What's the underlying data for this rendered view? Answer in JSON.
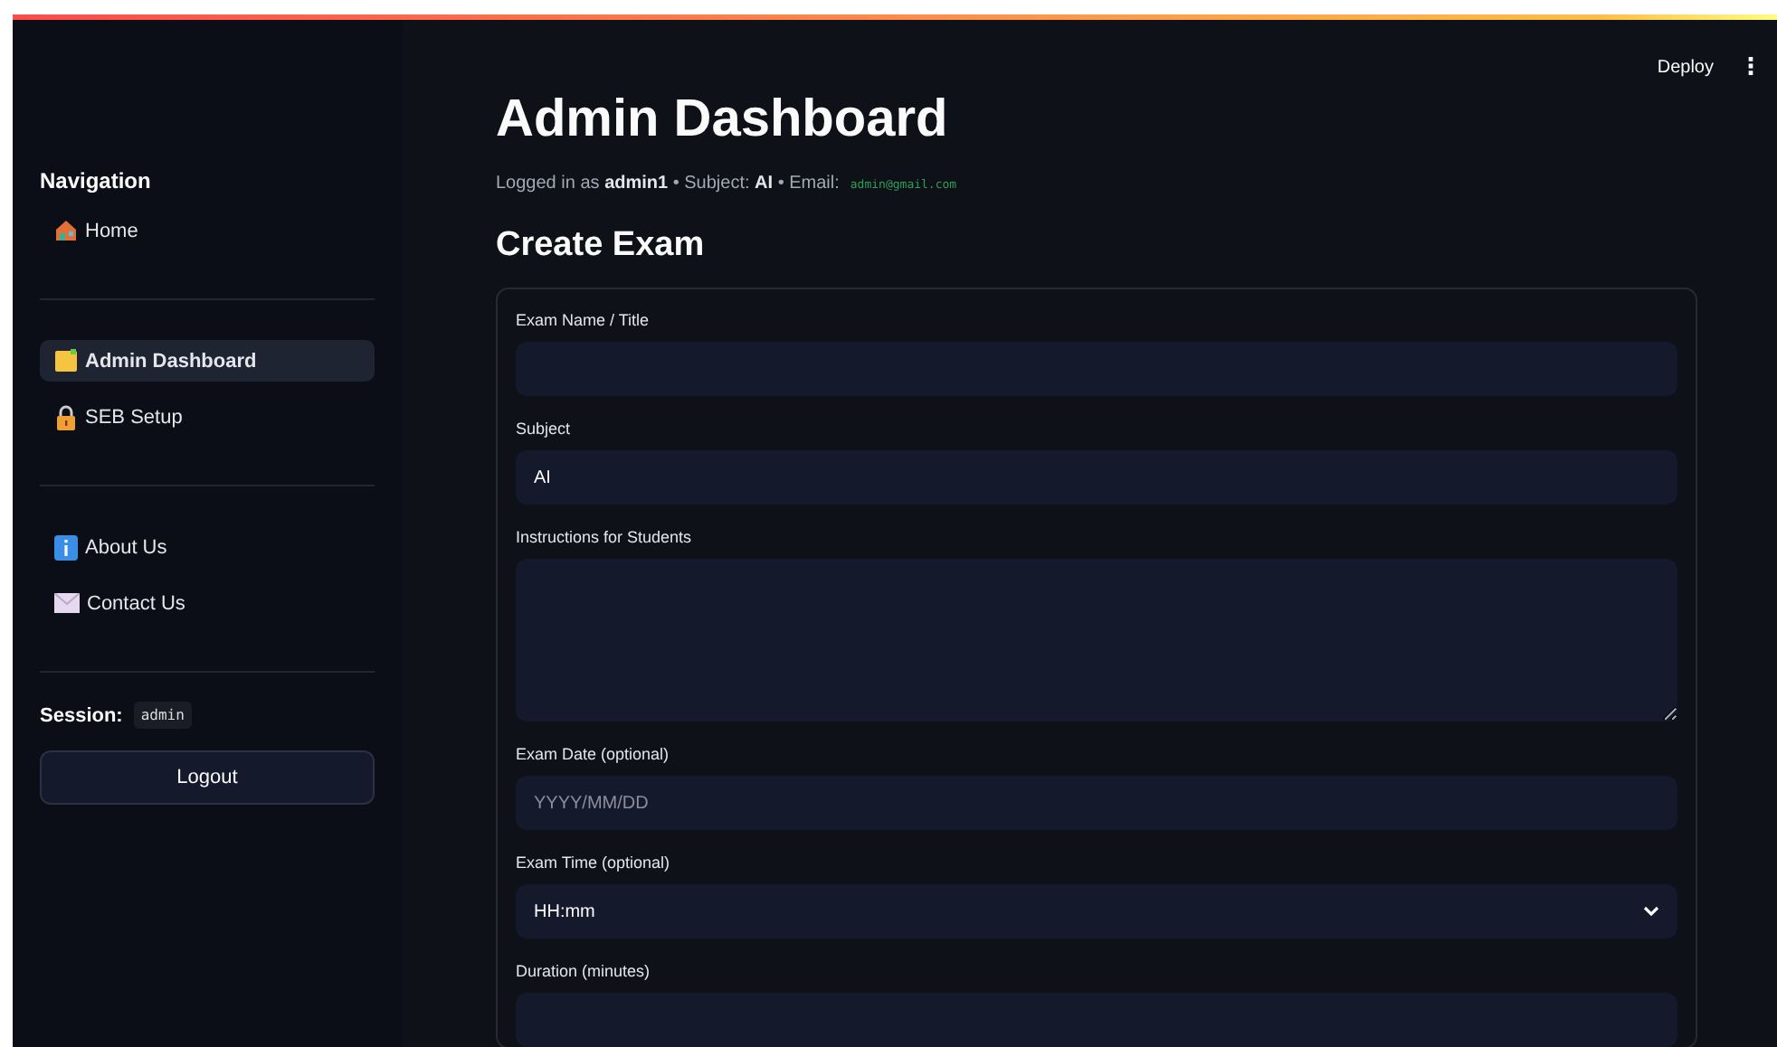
{
  "toolbar": {
    "deploy": "Deploy",
    "menu": "⋮"
  },
  "sidebar": {
    "heading": "Navigation",
    "groups": [
      [
        {
          "label": "Home",
          "selected": false
        }
      ],
      [
        {
          "label": "Admin Dashboard",
          "selected": true
        },
        {
          "label": "SEB Setup",
          "selected": false
        }
      ],
      [
        {
          "label": "About Us",
          "selected": false
        },
        {
          "label": "Contact Us",
          "selected": false
        }
      ]
    ],
    "session_label": "Session:",
    "session_value": "admin",
    "logout": "Logout"
  },
  "main": {
    "title": "Admin Dashboard",
    "login_line": "Logged in as **admin1** • Subject: **AI** • Email:",
    "email": "admin@gmail.com",
    "section": "Create Exam",
    "fields": [
      {
        "kind": "text",
        "label": "Exam Name / Title"
      },
      {
        "kind": "text",
        "label": "Subject",
        "value": "AI"
      },
      {
        "kind": "textarea",
        "label": "Instructions for Students"
      },
      {
        "kind": "text",
        "label": "Exam Date (optional)",
        "placeholder": "YYYY/MM/DD"
      },
      {
        "kind": "select",
        "label": "Exam Time (optional)",
        "value": "HH:mm"
      },
      {
        "kind": "text",
        "label": "Duration (minutes)"
      }
    ]
  }
}
